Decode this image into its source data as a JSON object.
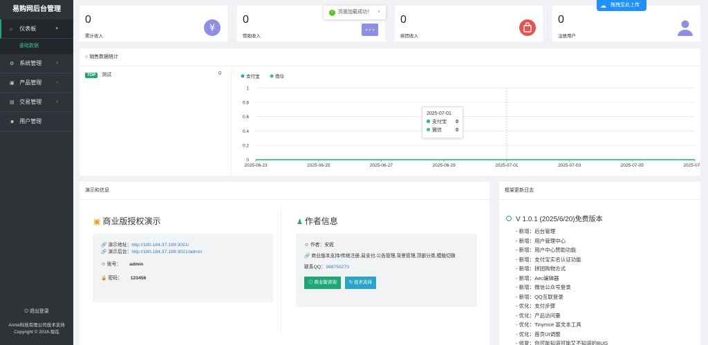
{
  "app": {
    "title": "易购网后台管理"
  },
  "sidebar": {
    "items": [
      {
        "label": "仪表板",
        "icon": "home-icon"
      },
      {
        "label": "系统管理",
        "icon": "gear-icon"
      },
      {
        "label": "产品管理",
        "icon": "product-icon"
      },
      {
        "label": "交易管理",
        "icon": "trade-icon"
      },
      {
        "label": "用户管理",
        "icon": "users-icon"
      }
    ],
    "subitem": "基础数据",
    "logout": "退出登录",
    "footer_line1": "Annie科技有限公司技术支持",
    "footer_line2": "Copyright © 2018-现在"
  },
  "stats": [
    {
      "value": "0",
      "label": "累计收入"
    },
    {
      "value": "0",
      "label": "赞助收入"
    },
    {
      "value": "0",
      "label": "拼团收入"
    },
    {
      "value": "0",
      "label": "注册用户"
    }
  ],
  "toast": {
    "text": "页面加载成功！",
    "close": "×"
  },
  "upload": {
    "label": "拖拽至此上传"
  },
  "sales": {
    "title": "销售数据统计",
    "list": [
      {
        "badge": "TOP",
        "name": "测试",
        "count": "0"
      }
    ]
  },
  "chart_data": {
    "type": "line",
    "x": [
      "2025-06-23",
      "2025-06-24",
      "2025-06-25",
      "2025-06-26",
      "2025-06-27",
      "2025-06-28",
      "2025-06-29",
      "2025-06-30",
      "2025-07-01",
      "2025-07-02",
      "2025-07-03",
      "2025-07-04",
      "2025-07-05",
      "2025-07-06",
      "2025-07-07"
    ],
    "tick_labels": [
      "2025-06-23",
      "2025-06-25",
      "2025-06-27",
      "2025-06-29",
      "2025-07-01",
      "2025-07-03",
      "2025-07-05",
      "2025-07-07"
    ],
    "series": [
      {
        "name": "支付宝",
        "color": "#2aa4c8",
        "values": [
          0,
          0,
          0,
          0,
          0,
          0,
          0,
          0,
          0,
          0,
          0,
          0,
          0,
          0,
          0
        ]
      },
      {
        "name": "微信",
        "color": "#2ec28e",
        "values": [
          0,
          0,
          0,
          0,
          0,
          0,
          0,
          0,
          0,
          0,
          0,
          0,
          0,
          0,
          0
        ]
      }
    ],
    "ylim": [
      0,
      1
    ],
    "yticks": [
      "1",
      "0.8",
      "0.6",
      "0.4",
      "0.2",
      "0"
    ],
    "legend": "top-left",
    "tooltip": {
      "date": "2025-07-01",
      "rows": [
        {
          "name": "支付宝",
          "value": "0"
        },
        {
          "name": "微信",
          "value": "0"
        }
      ]
    }
  },
  "demo": {
    "section_title": "演示和信息",
    "title": "商业版授权演示",
    "url1_label": "演示地址：",
    "url1": "http://180.184.37.199:3021/",
    "url2_label": "演示后台：",
    "url2": "http://180.184.37.199:3021/admin",
    "account_label": "账号：",
    "account": "admin",
    "password_label": "密码：",
    "password": "123456"
  },
  "author": {
    "title": "作者信息",
    "author_line": "作者：安妮",
    "features": "商业版本支持/传统注册,易支付,公告管理,背景管理,顶部分类,模版切换",
    "qq_label": "联系QQ：",
    "qq": "368750270",
    "btn1": "商业版咨询",
    "btn2": "技术支持"
  },
  "changelog": {
    "title": "框架更新日志",
    "version": "V 1.0.1 (2025/6/20)免费版本",
    "items": [
      "- 新增：后台管理",
      "- 新增：用户管理中心",
      "- 新增：用户中心赞助功能",
      "- 新增：支付宝实名认证功能",
      "- 新增：拼团购物方式",
      "- 新增：Aec编辑器",
      "- 新增：微信公众号登录",
      "- 新增：QQ互联登录",
      "- 优化：支付步骤",
      "- 优化：产品访问量",
      "- 优化：Tinymce 富文本工具",
      "- 优化：首页UI调整",
      "- 修复：你可能知道可能又不知道的BUG"
    ]
  }
}
